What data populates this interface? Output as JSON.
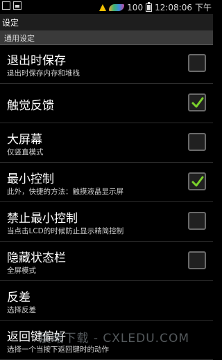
{
  "status_bar": {
    "time": "12:08:06",
    "period": "下午",
    "battery_text": "100"
  },
  "title_bar": {
    "title": "设定"
  },
  "section": {
    "label": "通用设定"
  },
  "settings": [
    {
      "title": "退出时保存",
      "summary": "退出时保存内存和堆栈",
      "checked": false
    },
    {
      "title": "触觉反馈",
      "summary": "",
      "checked": true
    },
    {
      "title": "大屏幕",
      "summary": "仅竖直模式",
      "checked": false
    },
    {
      "title": "最小控制",
      "summary": "此外，快捷的方法：触摸液晶显示屏",
      "checked": true
    },
    {
      "title": "禁止最小控制",
      "summary": "当点击LCD的时候防止显示精简控制",
      "checked": false
    },
    {
      "title": "隐藏状态栏",
      "summary": "全屏模式",
      "checked": false
    },
    {
      "title": "反差",
      "summary": "选择反差"
    },
    {
      "title": "返回键偏好",
      "summary": "选择一个当按下返回键时的动作"
    }
  ],
  "watermark": {
    "text": "晨曦下载 - CXLEDU.COM"
  },
  "colors": {
    "check_green": "#7bd12b",
    "section_bg": "#3a3a3a"
  }
}
